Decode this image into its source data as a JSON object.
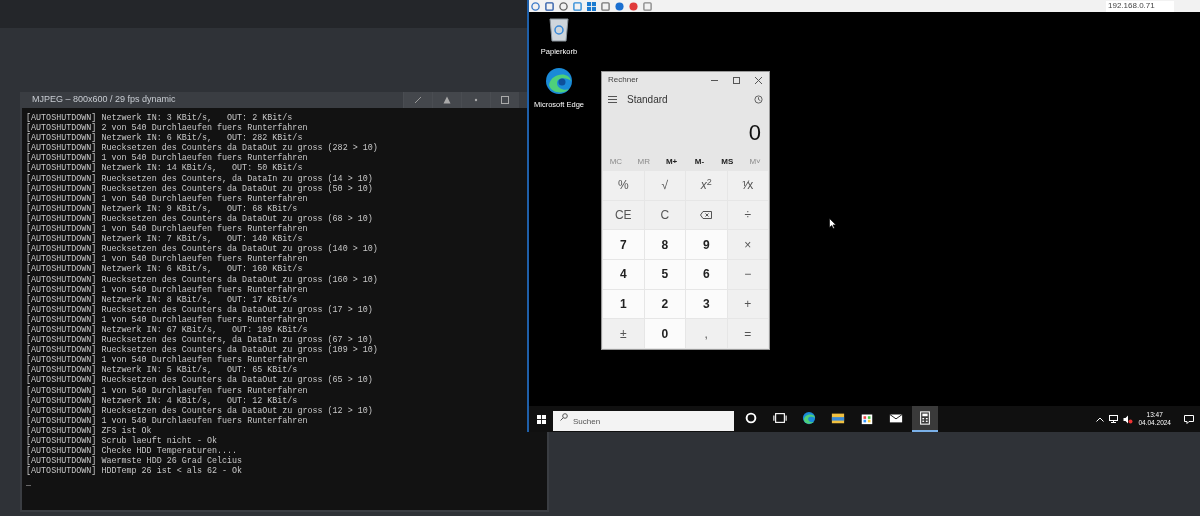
{
  "viewer": {
    "title": "MJPEG – 800x600 / 29 fps dynamic"
  },
  "terminal": {
    "lines": [
      "[AUTOSHUTDOWN] Netzwerk IN: 3 KBit/s,   OUT: 2 KBit/s",
      "[AUTOSHUTDOWN] 2 von 540 Durchlaeufen fuers Runterfahren",
      "[AUTOSHUTDOWN] Netzwerk IN: 6 KBit/s,   OUT: 282 KBit/s",
      "[AUTOSHUTDOWN] Ruecksetzen des Counters da DataOut zu gross (282 > 10)",
      "[AUTOSHUTDOWN] 1 von 540 Durchlaeufen fuers Runterfahren",
      "[AUTOSHUTDOWN] Netzwerk IN: 14 KBit/s,   OUT: 50 KBit/s",
      "[AUTOSHUTDOWN] Ruecksetzen des Counters, da DataIn zu gross (14 > 10)",
      "[AUTOSHUTDOWN] Ruecksetzen des Counters da DataOut zu gross (50 > 10)",
      "[AUTOSHUTDOWN] 1 von 540 Durchlaeufen fuers Runterfahren",
      "[AUTOSHUTDOWN] Netzwerk IN: 9 KBit/s,   OUT: 68 KBit/s",
      "[AUTOSHUTDOWN] Ruecksetzen des Counters da DataOut zu gross (68 > 10)",
      "[AUTOSHUTDOWN] 1 von 540 Durchlaeufen fuers Runterfahren",
      "[AUTOSHUTDOWN] Netzwerk IN: 7 KBit/s,   OUT: 140 KBit/s",
      "[AUTOSHUTDOWN] Ruecksetzen des Counters da DataOut zu gross (140 > 10)",
      "[AUTOSHUTDOWN] 1 von 540 Durchlaeufen fuers Runterfahren",
      "[AUTOSHUTDOWN] Netzwerk IN: 6 KBit/s,   OUT: 160 KBit/s",
      "[AUTOSHUTDOWN] Ruecksetzen des Counters da DataOut zu gross (160 > 10)",
      "[AUTOSHUTDOWN] 1 von 540 Durchlaeufen fuers Runterfahren",
      "[AUTOSHUTDOWN] Netzwerk IN: 8 KBit/s,   OUT: 17 KBit/s",
      "[AUTOSHUTDOWN] Ruecksetzen des Counters da DataOut zu gross (17 > 10)",
      "[AUTOSHUTDOWN] 1 von 540 Durchlaeufen fuers Runterfahren",
      "[AUTOSHUTDOWN] Netzwerk IN: 67 KBit/s,   OUT: 109 KBit/s",
      "[AUTOSHUTDOWN] Ruecksetzen des Counters, da DataIn zu gross (67 > 10)",
      "[AUTOSHUTDOWN] Ruecksetzen des Counters da DataOut zu gross (109 > 10)",
      "[AUTOSHUTDOWN] 1 von 540 Durchlaeufen fuers Runterfahren",
      "[AUTOSHUTDOWN] Netzwerk IN: 5 KBit/s,   OUT: 65 KBit/s",
      "[AUTOSHUTDOWN] Ruecksetzen des Counters da DataOut zu gross (65 > 10)",
      "[AUTOSHUTDOWN] 1 von 540 Durchlaeufen fuers Runterfahren",
      "[AUTOSHUTDOWN] Netzwerk IN: 4 KBit/s,   OUT: 12 KBit/s",
      "[AUTOSHUTDOWN] Ruecksetzen des Counters da DataOut zu gross (12 > 10)",
      "[AUTOSHUTDOWN] 1 von 540 Durchlaeufen fuers Runterfahren",
      "[AUTOSHUTDOWN] ZFS ist Ok",
      "[AUTOSHUTDOWN] Scrub laeuft nicht - Ok",
      "[AUTOSHUTDOWN] Checke HDD Temperaturen....",
      "[AUTOSHUTDOWN] Waermste HDD 26 Grad Celcius",
      "[AUTOSHUTDOWN] HDDTemp 26 ist < als 62 - Ok"
    ],
    "cursor": "_"
  },
  "remote": {
    "address": "192.168.0.71",
    "desktop_icons": [
      {
        "kind": "recycle",
        "label": "Papierkorb"
      },
      {
        "kind": "edge",
        "label": "Microsoft Edge"
      }
    ],
    "calculator": {
      "title": "Rechner",
      "mode": "Standard",
      "display": "0",
      "memory": [
        {
          "label": "MC",
          "disabled": true
        },
        {
          "label": "MR",
          "disabled": true
        },
        {
          "label": "M+",
          "disabled": false
        },
        {
          "label": "M-",
          "disabled": false
        },
        {
          "label": "MS",
          "disabled": false
        },
        {
          "label": "M˅",
          "disabled": true
        }
      ],
      "keys": [
        {
          "kind": "function",
          "label": "%"
        },
        {
          "kind": "function",
          "label": "√"
        },
        {
          "kind": "function",
          "label": "*x*$^{2}$"
        },
        {
          "kind": "function",
          "label": "⅟x"
        },
        {
          "kind": "function",
          "label": "CE"
        },
        {
          "kind": "function",
          "label": "C"
        },
        {
          "kind": "backspace"
        },
        {
          "kind": "function",
          "label": "÷"
        },
        {
          "kind": "digit",
          "label": "7"
        },
        {
          "kind": "digit",
          "label": "8"
        },
        {
          "kind": "digit",
          "label": "9"
        },
        {
          "kind": "function",
          "label": "×"
        },
        {
          "kind": "digit",
          "label": "4"
        },
        {
          "kind": "digit",
          "label": "5"
        },
        {
          "kind": "digit",
          "label": "6"
        },
        {
          "kind": "function",
          "label": "−"
        },
        {
          "kind": "digit",
          "label": "1"
        },
        {
          "kind": "digit",
          "label": "2"
        },
        {
          "kind": "digit",
          "label": "3"
        },
        {
          "kind": "function",
          "label": "+"
        },
        {
          "kind": "function",
          "label": "±"
        },
        {
          "kind": "digit",
          "label": "0"
        },
        {
          "kind": "function",
          "label": ","
        },
        {
          "kind": "function",
          "label": "="
        }
      ]
    },
    "taskbar": {
      "search_placeholder": "Suchen",
      "apps": [
        {
          "kind": "cortana",
          "selected": false
        },
        {
          "kind": "taskview",
          "selected": false
        },
        {
          "kind": "edge",
          "selected": false
        },
        {
          "kind": "explorer",
          "selected": false
        },
        {
          "kind": "store",
          "selected": false
        },
        {
          "kind": "mail",
          "selected": false
        },
        {
          "kind": "calculator",
          "selected": true
        }
      ],
      "time": "13:47",
      "date": "04.04.2024"
    }
  }
}
